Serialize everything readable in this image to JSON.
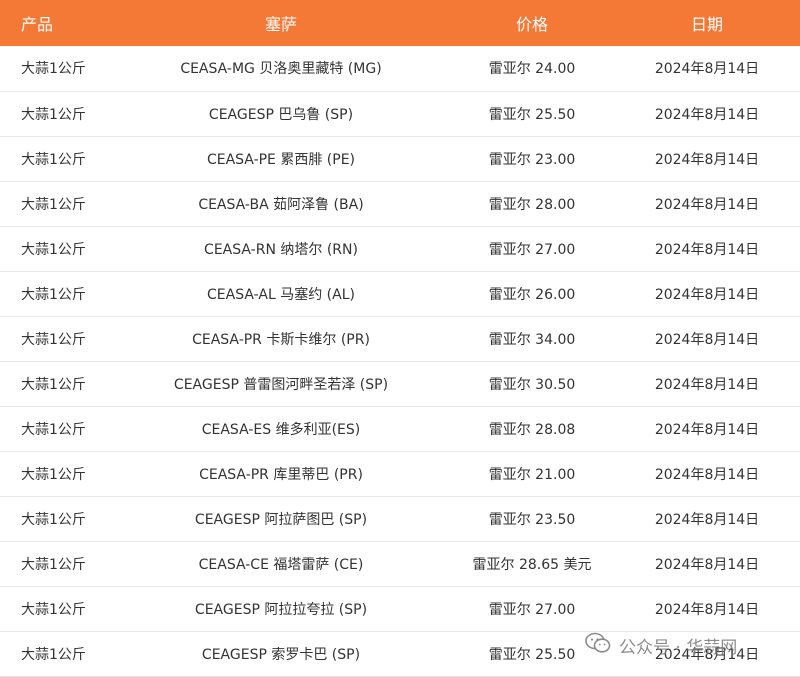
{
  "headers": {
    "product": "产品",
    "market": "塞萨",
    "price": "价格",
    "date": "日期"
  },
  "rows": [
    {
      "product": "大蒜1公斤",
      "market": "CEASA-MG 贝洛奥里藏特 (MG)",
      "price": "雷亚尔 24.00",
      "date": "2024年8月14日"
    },
    {
      "product": "大蒜1公斤",
      "market": "CEAGESP 巴乌鲁 (SP)",
      "price": "雷亚尔 25.50",
      "date": "2024年8月14日"
    },
    {
      "product": "大蒜1公斤",
      "market": "CEASA-PE 累西腓 (PE)",
      "price": "雷亚尔 23.00",
      "date": "2024年8月14日"
    },
    {
      "product": "大蒜1公斤",
      "market": "CEASA-BA 茹阿泽鲁 (BA)",
      "price": "雷亚尔 28.00",
      "date": "2024年8月14日"
    },
    {
      "product": "大蒜1公斤",
      "market": "CEASA-RN 纳塔尔 (RN)",
      "price": "雷亚尔 27.00",
      "date": "2024年8月14日"
    },
    {
      "product": "大蒜1公斤",
      "market": "CEASA-AL 马塞约 (AL)",
      "price": "雷亚尔 26.00",
      "date": "2024年8月14日"
    },
    {
      "product": "大蒜1公斤",
      "market": "CEASA-PR 卡斯卡维尔 (PR)",
      "price": "雷亚尔 34.00",
      "date": "2024年8月14日"
    },
    {
      "product": "大蒜1公斤",
      "market": "CEAGESP 普雷图河畔圣若泽 (SP)",
      "price": "雷亚尔 30.50",
      "date": "2024年8月14日"
    },
    {
      "product": "大蒜1公斤",
      "market": "CEASA-ES 维多利亚(ES)",
      "price": "雷亚尔 28.08",
      "date": "2024年8月14日"
    },
    {
      "product": "大蒜1公斤",
      "market": "CEASA-PR 库里蒂巴 (PR)",
      "price": "雷亚尔 21.00",
      "date": "2024年8月14日"
    },
    {
      "product": "大蒜1公斤",
      "market": "CEAGESP 阿拉萨图巴 (SP)",
      "price": "雷亚尔 23.50",
      "date": "2024年8月14日"
    },
    {
      "product": "大蒜1公斤",
      "market": "CEASA-CE 福塔雷萨 (CE)",
      "price": "雷亚尔 28.65 美元",
      "date": "2024年8月14日"
    },
    {
      "product": "大蒜1公斤",
      "market": "CEAGESP 阿拉拉夸拉 (SP)",
      "price": "雷亚尔 27.00",
      "date": "2024年8月14日"
    },
    {
      "product": "大蒜1公斤",
      "market": "CEAGESP 索罗卡巴 (SP)",
      "price": "雷亚尔 25.50",
      "date": "2024年8月14日"
    }
  ],
  "watermark": {
    "icon": "wechat-icon",
    "text": "公众号 · 华蒜网"
  },
  "colors": {
    "header_bg": "#f47937",
    "header_text": "#ffffff",
    "row_divider": "#e8e8e8",
    "body_text": "#333333"
  }
}
